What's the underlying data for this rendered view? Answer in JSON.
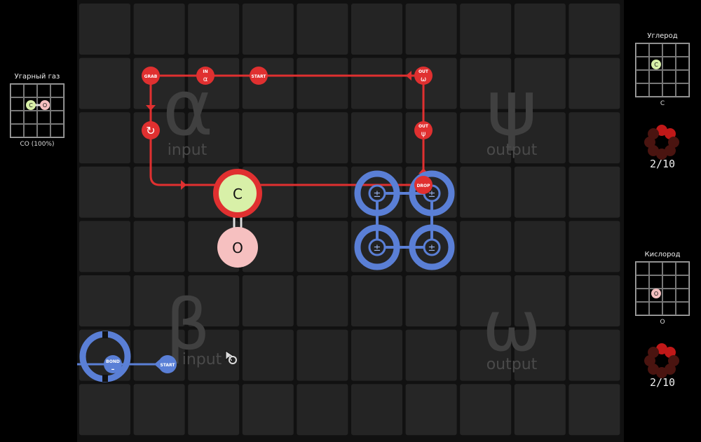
{
  "zones": {
    "alpha": {
      "glyph": "α",
      "label": "input"
    },
    "beta": {
      "glyph": "β",
      "label": "input"
    },
    "psi": {
      "glyph": "ψ",
      "label": "output"
    },
    "omega": {
      "glyph": "ω",
      "label": "output"
    }
  },
  "instructions": {
    "red": {
      "grab": "GRAB",
      "in_label": "IN",
      "in_glyph": "α",
      "start": "START",
      "out1_label": "OUT",
      "out1_glyph": "ω",
      "out2_label": "OUT",
      "out2_glyph": "ψ",
      "drop": "DROP",
      "rotate": "↻"
    },
    "blue": {
      "bond": "BOND",
      "bond_sign": "–",
      "start": "START"
    }
  },
  "atoms": {
    "carbon": "C",
    "oxygen": "O",
    "bonder": "±"
  },
  "left_panel": {
    "title": "Угарный газ",
    "atom1": "C",
    "atom2": "O",
    "caption": "CO (100%)"
  },
  "right_panels": [
    {
      "title": "Углерод",
      "atom": "C",
      "caption": "C",
      "counter": "2/10",
      "progress": 0.2
    },
    {
      "title": "Кислород",
      "atom": "O",
      "caption": "O",
      "counter": "2/10",
      "progress": 0.2
    }
  ],
  "colors": {
    "red": "#e03030",
    "blue": "#5a7fd6",
    "carbon": "#d8f0a8",
    "oxygen": "#f6c0c0"
  }
}
